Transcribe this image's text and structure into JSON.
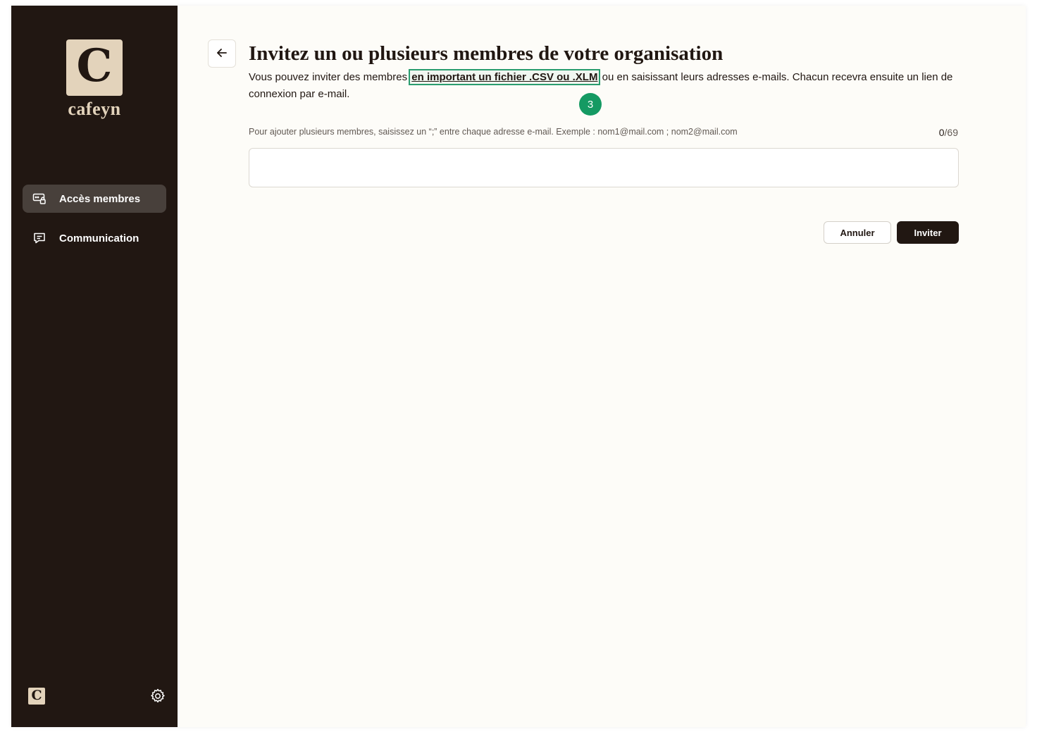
{
  "brand": {
    "logo_letter": "C",
    "wordmark": "cafeyn",
    "bottom_logo_letter": "C",
    "colors": {
      "sidebar": "#211712",
      "logo_bg": "#e3d3bb",
      "accent_green": "#159a63",
      "primary_button": "#211712"
    }
  },
  "sidebar": {
    "items": [
      {
        "label": "Accès membres",
        "icon": "member-access-icon",
        "active": true
      },
      {
        "label": "Communication",
        "icon": "chat-message-icon",
        "active": false
      }
    ],
    "settings_icon": "gear-icon"
  },
  "main": {
    "back_icon": "arrow-left-icon",
    "title": "Invitez un ou plusieurs membres de votre organisation",
    "description": {
      "before": "Vous pouvez inviter des membres ",
      "link": "en important un fichier .CSV ou .XLM",
      "after": " ou en saisissant leurs adresses e-mails. Chacun recevra ensuite un lien de connexion par e-mail."
    },
    "step_badge": "3",
    "hint": "Pour ajouter plusieurs membres, saisissez un “;” entre chaque adresse e-mail. Exemple : nom1@mail.com ; nom2@mail.com",
    "counter": {
      "current": "0",
      "max": "/69"
    },
    "email_input": {
      "value": "",
      "placeholder": ""
    },
    "buttons": {
      "cancel": "Annuler",
      "invite": "Inviter"
    }
  }
}
